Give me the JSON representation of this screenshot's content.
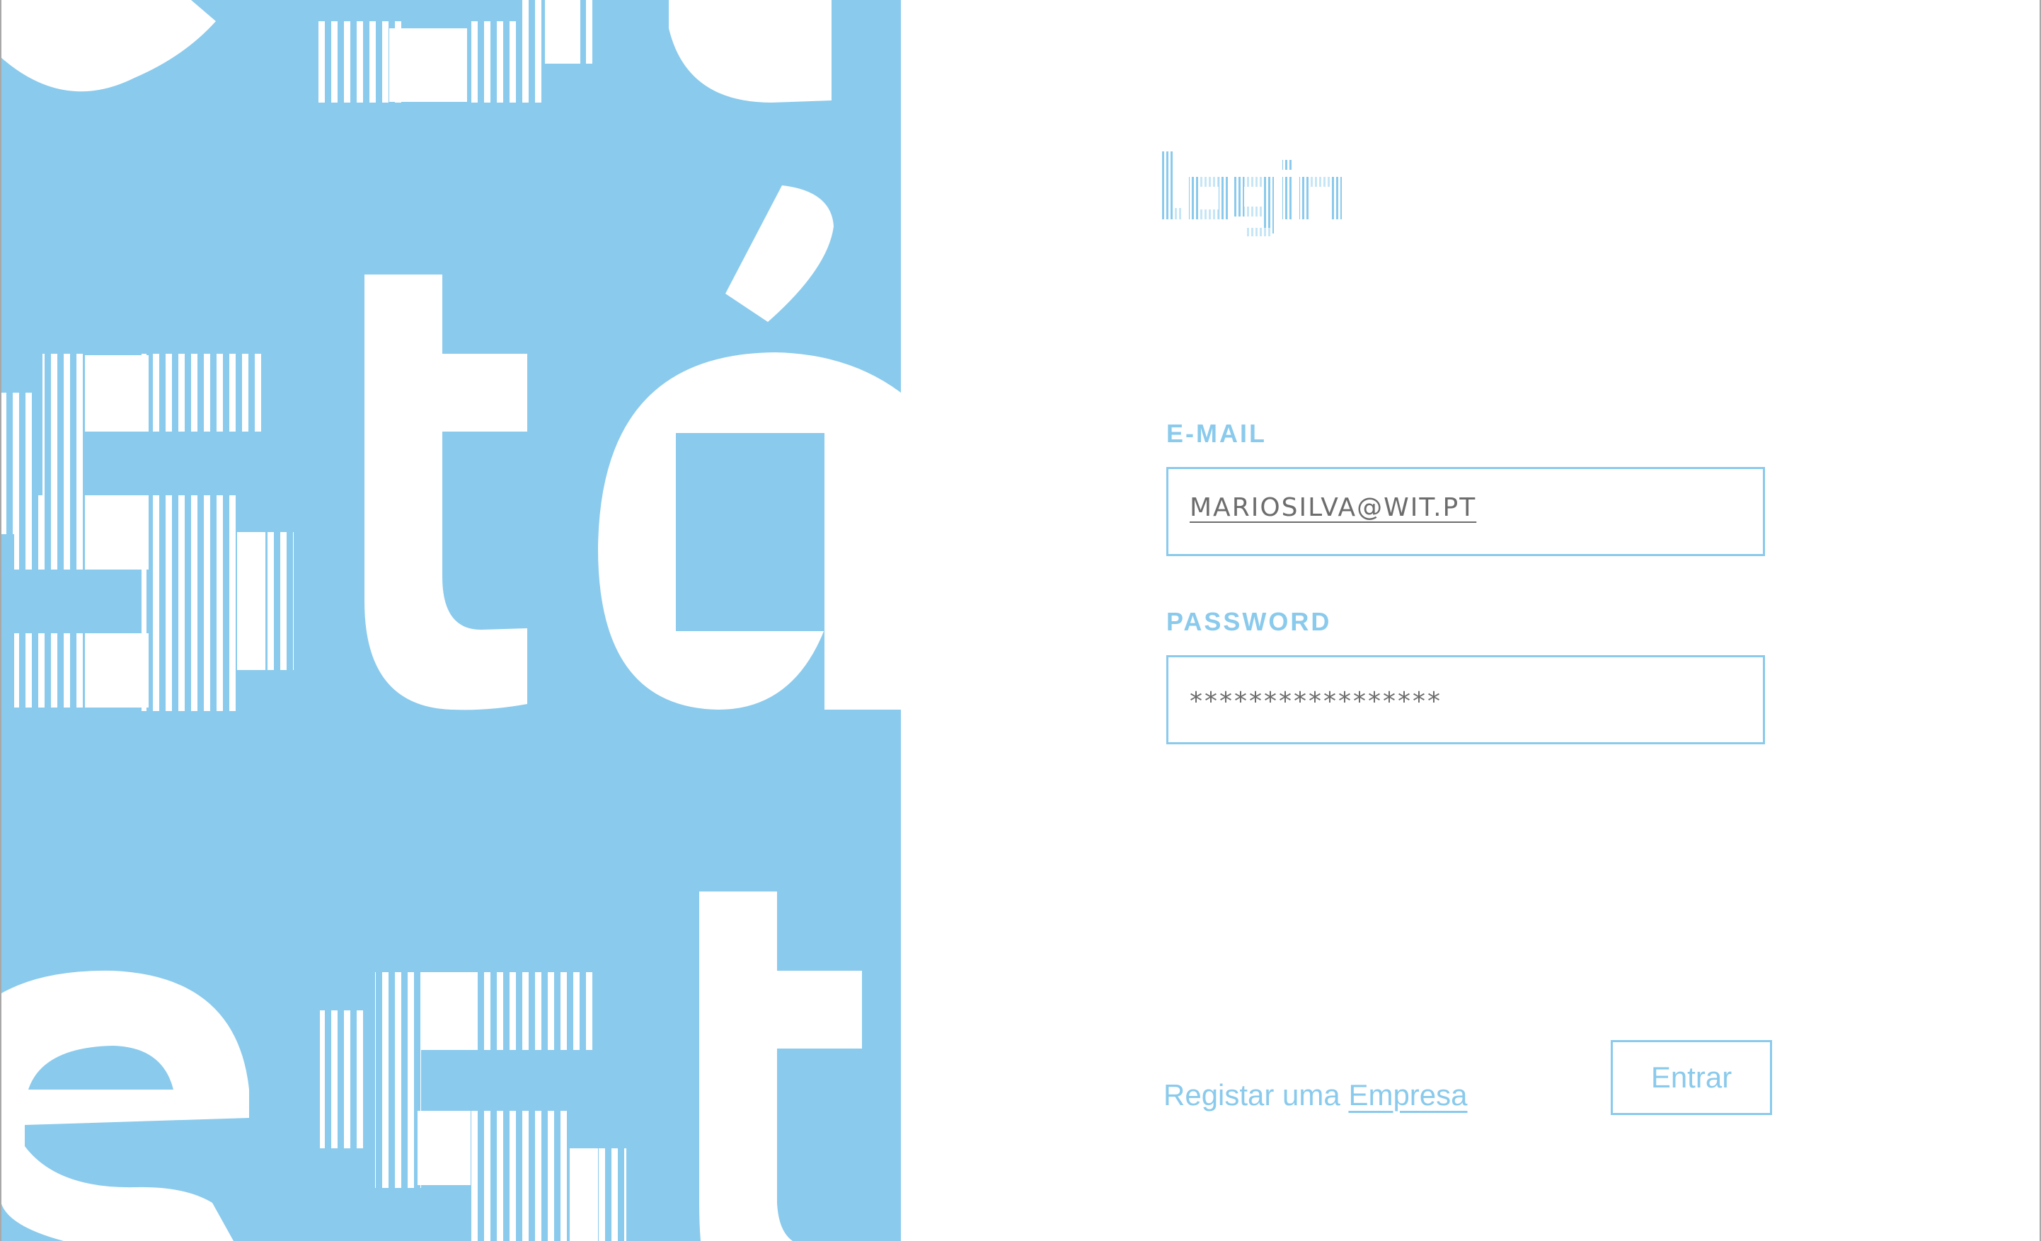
{
  "theme": {
    "accent": "#8acaec",
    "panel_background": "#8acaec",
    "field_text_color": "#6d6d6d",
    "background": "#ffffff"
  },
  "brand": {
    "logo_text": "login",
    "icon": "striped-wordmark-logo"
  },
  "decorative_art": {
    "lettering": [
      "e",
      "t",
      "é",
      "s",
      "t",
      "á",
      "e",
      "s",
      "t"
    ],
    "icon": "striped-typography-art"
  },
  "form": {
    "email": {
      "label": "E-MAIL",
      "value": "MARIOSILVA@WIT.PT"
    },
    "password": {
      "label": "PASSWORD",
      "value": "*****************"
    },
    "register": {
      "prefix": "Registar uma",
      "link": "Empresa"
    },
    "submit_label": "Entrar"
  }
}
